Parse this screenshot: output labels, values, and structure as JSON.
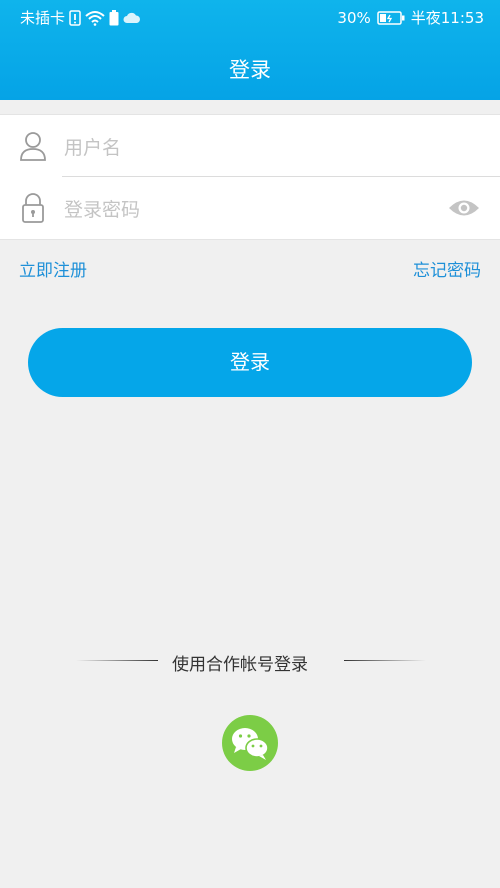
{
  "status_bar": {
    "carrier": "未插卡",
    "battery": "30%",
    "time": "半夜11:53"
  },
  "header": {
    "title": "登录"
  },
  "form": {
    "username_placeholder": "用户名",
    "password_placeholder": "登录密码"
  },
  "links": {
    "register": "立即注册",
    "forgot": "忘记密码"
  },
  "login_button": "登录",
  "third_party": {
    "label": "使用合作帐号登录",
    "wechat_icon": "wechat-icon"
  },
  "colors": {
    "primary": "#05a6e9",
    "link": "#1e90d8",
    "wechat": "#7ccd46"
  }
}
